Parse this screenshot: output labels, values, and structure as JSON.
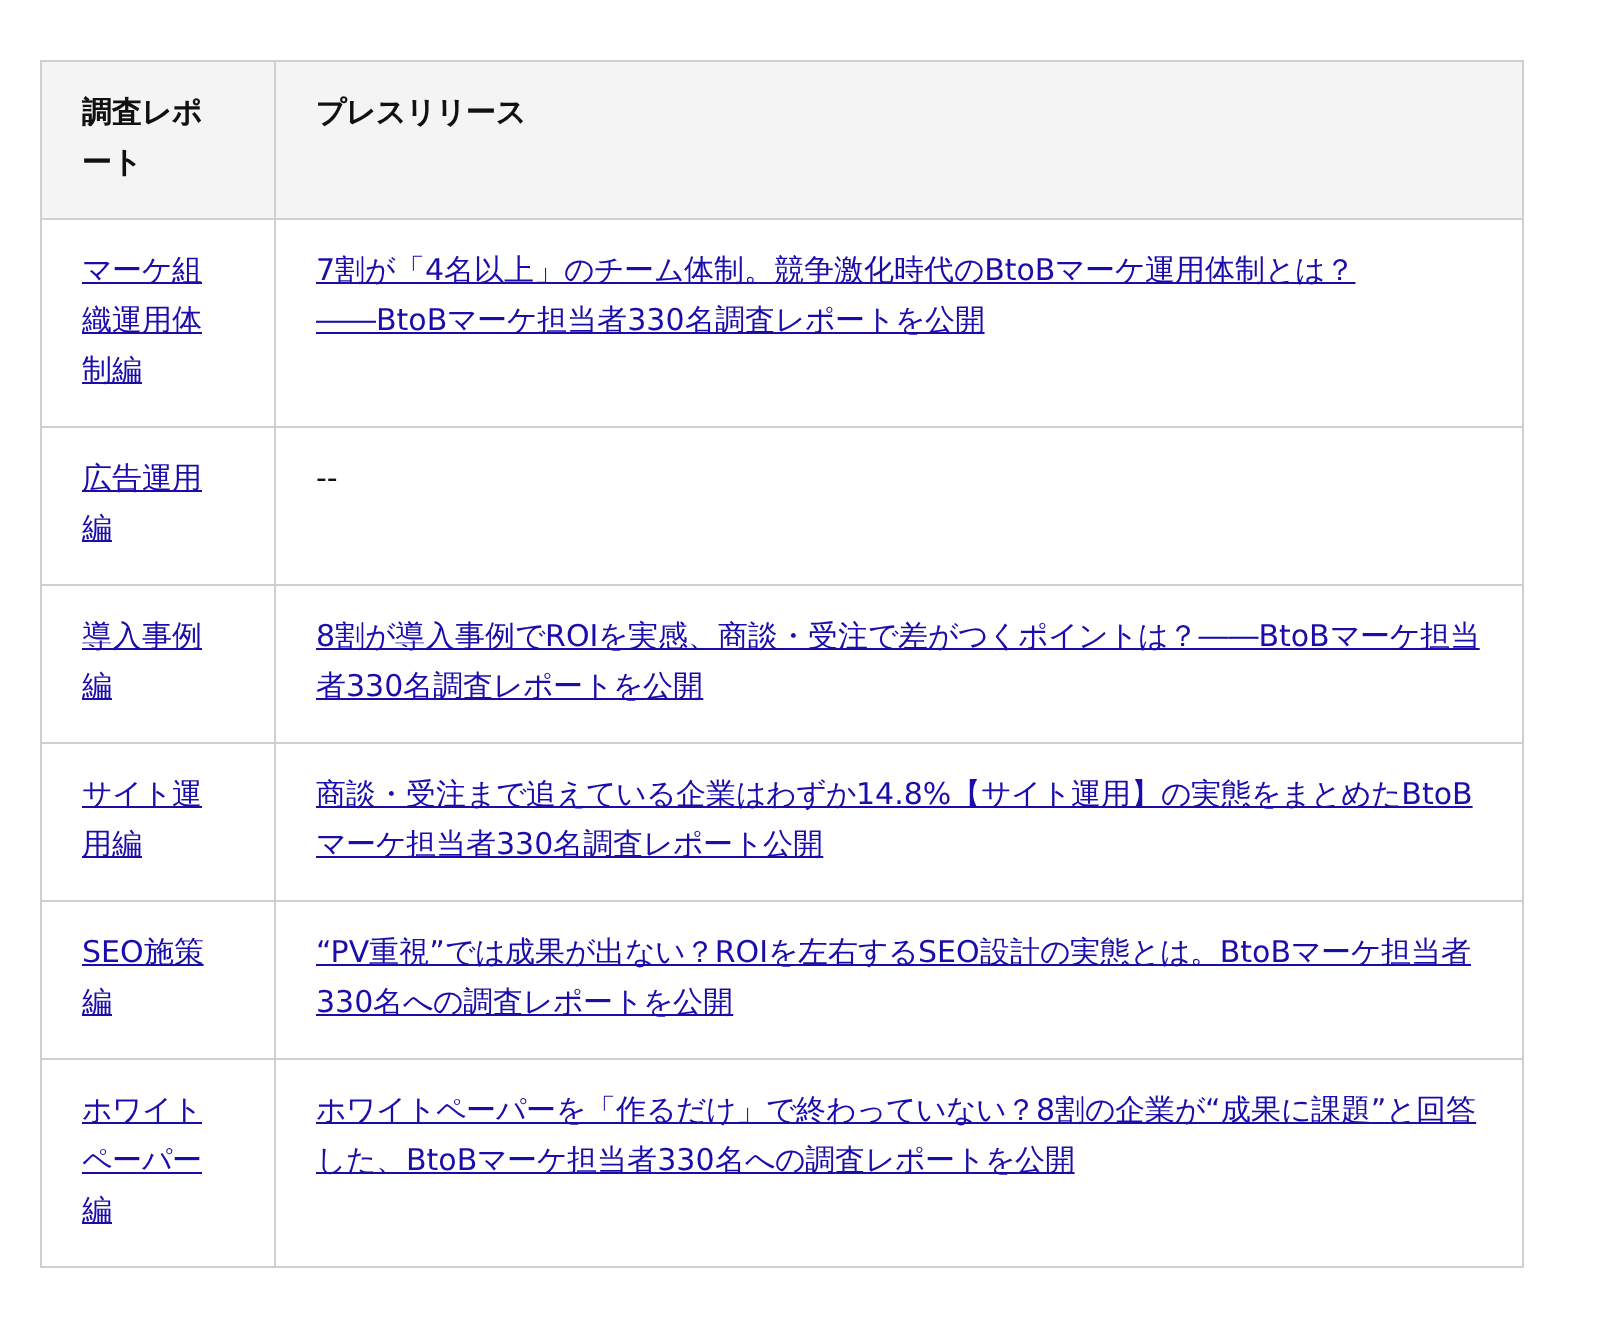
{
  "table": {
    "columns": [
      "調査レポート",
      "プレスリリース"
    ],
    "rows": [
      {
        "report": "マーケ組織運用体制編",
        "release": {
          "kind": "link",
          "text": "7割が「4名以上」のチーム体制。競争激化時代のBtoBマーケ運用体制とは？――BtoBマーケ担当者330名調査レポートを公開"
        }
      },
      {
        "report": "広告運用編",
        "release": {
          "kind": "text",
          "text": "--"
        }
      },
      {
        "report": "導入事例編",
        "release": {
          "kind": "link",
          "text": "8割が導入事例でROIを実感、商談・受注で差がつくポイントは？――BtoBマーケ担当者330名調査レポートを公開"
        }
      },
      {
        "report": "サイト運用編",
        "release": {
          "kind": "link",
          "text": "商談・受注まで追えている企業はわずか14.8%【サイト運用】の実態をまとめたBtoBマーケ担当者330名調査レポート公開"
        }
      },
      {
        "report": "SEO施策編",
        "release": {
          "kind": "link",
          "text": "“PV重視”では成果が出ない？ROIを左右するSEO設計の実態とは。BtoBマーケ担当者330名への調査レポートを公開"
        }
      },
      {
        "report": "ホワイトペーパー編",
        "release": {
          "kind": "link",
          "text": "ホワイトペーパーを「作るだけ」で終わっていない？8割の企業が“成果に課題”と回答した、BtoBマーケ担当者330名への調査レポートを公開"
        }
      }
    ]
  }
}
